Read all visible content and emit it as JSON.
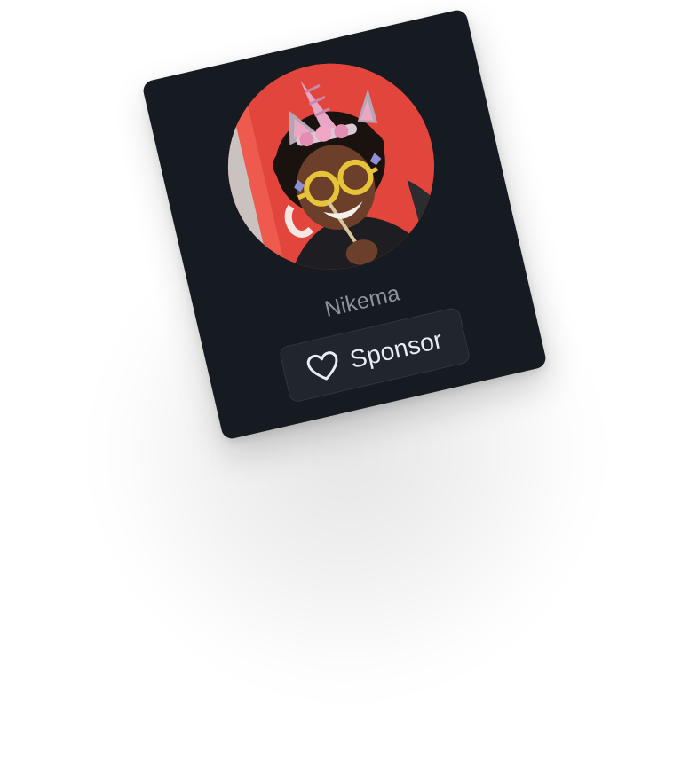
{
  "profile": {
    "name": "Nikema",
    "avatar_icon": "user-avatar-photo"
  },
  "sponsor": {
    "label": "Sponsor",
    "icon": "heart-icon"
  },
  "colors": {
    "card_bg": "#161b22",
    "button_bg": "#21262d",
    "button_border": "#30363d",
    "name_text": "#8b949e",
    "button_text": "#e6edf3",
    "avatar_bg": "#e2453c"
  }
}
